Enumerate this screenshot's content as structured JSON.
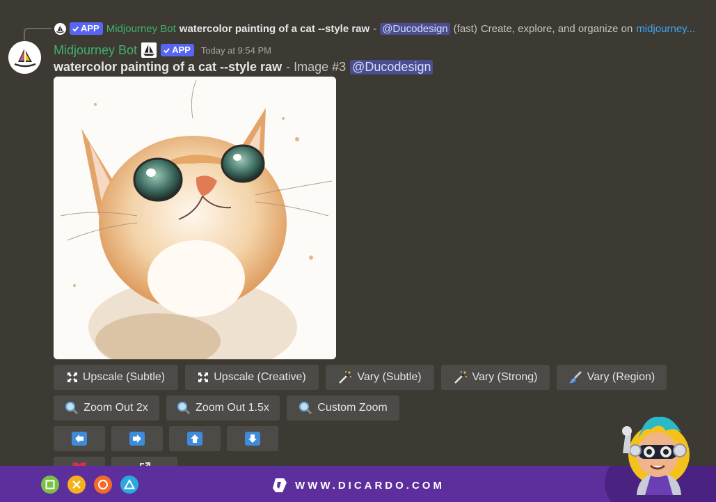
{
  "reply": {
    "badge": "APP",
    "bot_name": "Midjourney Bot",
    "prompt": "watercolor painting of a cat --style raw",
    "separator": "-",
    "mention": "@Ducodesign",
    "speed": "(fast)",
    "message": "Create, explore, and organize on",
    "link": "midjourney..."
  },
  "message": {
    "bot_name": "Midjourney Bot",
    "badge": "APP",
    "timestamp": "Today at 9:54 PM",
    "prompt": "watercolor painting of a cat --style raw",
    "image_label": "- Image #3",
    "mention": "@Ducodesign"
  },
  "buttons": {
    "row1": [
      {
        "label": "Upscale (Subtle)",
        "icon": "expand-icon"
      },
      {
        "label": "Upscale (Creative)",
        "icon": "expand-icon"
      },
      {
        "label": "Vary (Subtle)",
        "icon": "magic-wand-icon"
      },
      {
        "label": "Vary (Strong)",
        "icon": "magic-wand-icon"
      },
      {
        "label": "Vary (Region)",
        "icon": "paintbrush-icon"
      }
    ],
    "row2": [
      {
        "label": "Zoom Out 2x",
        "icon": "magnifier-icon"
      },
      {
        "label": "Zoom Out 1.5x",
        "icon": "magnifier-icon"
      },
      {
        "label": "Custom Zoom",
        "icon": "magnifier-icon"
      }
    ],
    "row3": [
      {
        "icon": "arrow-left-icon"
      },
      {
        "icon": "arrow-right-icon"
      },
      {
        "icon": "arrow-up-icon"
      },
      {
        "icon": "arrow-down-icon"
      }
    ],
    "row4": [
      {
        "icon": "heart-icon"
      },
      {
        "icon": "external-link-icon"
      }
    ]
  },
  "footer": {
    "brand": "WWW.DICARDO.COM",
    "controls": [
      "square-icon",
      "cross-icon",
      "circle-icon",
      "triangle-icon"
    ],
    "colors": {
      "background": "#5d2f9c",
      "square": "#7ac043",
      "cross": "#f5b11d",
      "circle": "#f26b2a",
      "triangle": "#2aa9df"
    }
  },
  "colors": {
    "background": "#3d3a33",
    "bot_name": "#3fb26a",
    "badge": "#5865f2",
    "mention_bg": "#4a4e8f",
    "link": "#3ea6f2"
  }
}
